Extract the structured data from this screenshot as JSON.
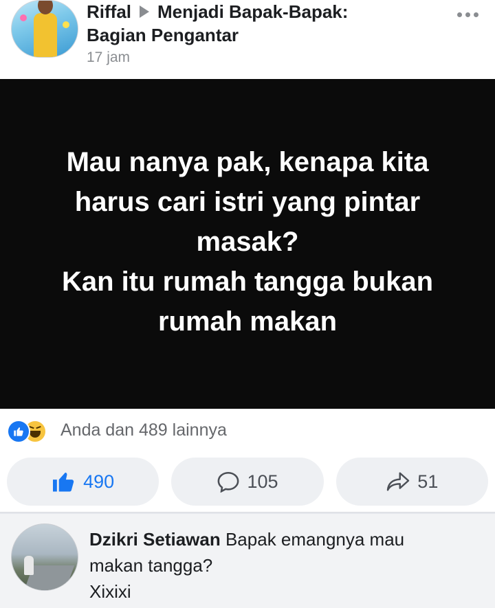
{
  "post": {
    "author": "Riffal",
    "group_line1": "Menjadi Bapak-Bapak:",
    "group_line2": "Bagian Pengantar",
    "timestamp": "17 jam",
    "image_text": [
      "Mau nanya pak, kenapa kita",
      "harus cari istri yang pintar",
      "masak?",
      "Kan itu rumah tangga bukan",
      "rumah makan"
    ],
    "more_icon": "ellipsis-icon"
  },
  "reactions": {
    "icons": [
      "like-icon",
      "haha-icon"
    ],
    "summary": "Anda dan 489 lainnya"
  },
  "actions": {
    "like_count": "490",
    "comment_count": "105",
    "share_count": "51",
    "like_color": "#1877f2"
  },
  "comment": {
    "author": "Dzikri Setiawan",
    "text_line1": "Bapak emangnya mau",
    "text_line2": "makan tangga?",
    "text_line3": "Xixixi"
  }
}
